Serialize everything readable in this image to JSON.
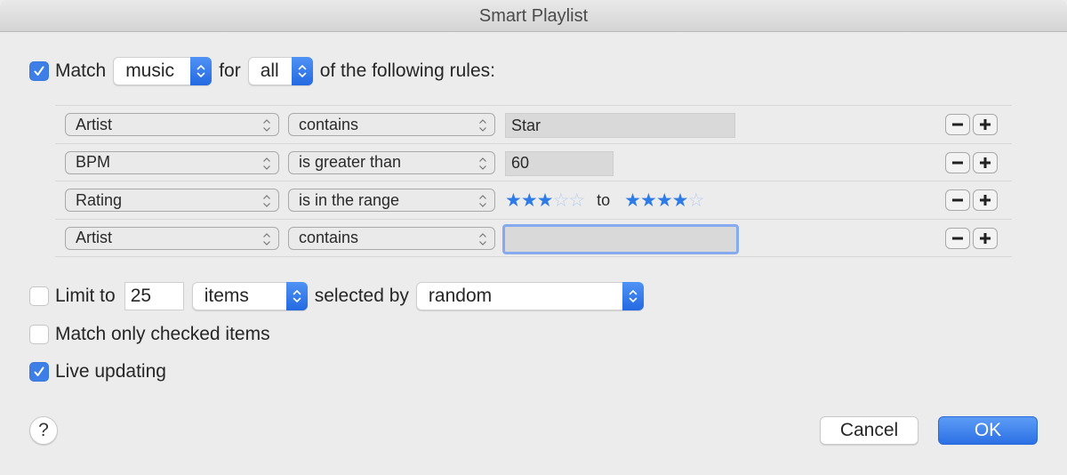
{
  "window": {
    "title": "Smart Playlist"
  },
  "match": {
    "checked": true,
    "label": "Match",
    "media_type": "music",
    "for_label": "for",
    "quantifier": "all",
    "suffix": "of the following rules:"
  },
  "rules": [
    {
      "field": "Artist",
      "operator": "contains",
      "value": "Star",
      "type": "text"
    },
    {
      "field": "BPM",
      "operator": "is greater than",
      "value": "60",
      "type": "text"
    },
    {
      "field": "Rating",
      "operator": "is in the range",
      "type": "rating",
      "from_stars": 3,
      "to_stars": 4,
      "max_stars": 5,
      "range_word": "to"
    },
    {
      "field": "Artist",
      "operator": "contains",
      "value": "",
      "type": "text",
      "focused": true
    }
  ],
  "rule_buttons": {
    "remove_icon": "minus-icon",
    "add_icon": "plus-icon"
  },
  "limit": {
    "checked": false,
    "label": "Limit to",
    "amount": "25",
    "unit": "items",
    "selected_by_label": "selected by",
    "selected_by": "random"
  },
  "match_checked": {
    "checked": false,
    "label": "Match only checked items"
  },
  "live_updating": {
    "checked": true,
    "label": "Live updating"
  },
  "footer": {
    "help": "?",
    "cancel": "Cancel",
    "ok": "OK"
  },
  "colors": {
    "accent": "#3d7fe6",
    "star_filled": "#2f7be6",
    "star_empty": "#b8cdef"
  }
}
